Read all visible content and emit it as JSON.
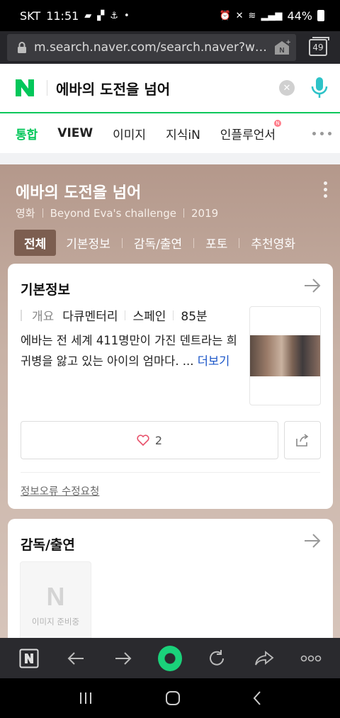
{
  "status_bar": {
    "carrier": "SKT",
    "time": "11:51",
    "battery": "44%"
  },
  "browser": {
    "url": "m.search.naver.com/search.naver?wher...",
    "tab_count": "49"
  },
  "search": {
    "query": "에바의 도전을 넘어"
  },
  "tabs": [
    {
      "label": "통합"
    },
    {
      "label": "VIEW"
    },
    {
      "label": "이미지"
    },
    {
      "label": "지식iN"
    },
    {
      "label": "인플루언서",
      "badge": "N"
    }
  ],
  "movie": {
    "title": "에바의 도전을 넘어",
    "category": "영화",
    "english_title": "Beyond Eva's challenge",
    "year": "2019",
    "subtabs": [
      "전체",
      "기본정보",
      "감독/출연",
      "포토",
      "추천영화"
    ]
  },
  "basic_info": {
    "heading": "기본정보",
    "overview_label": "개요",
    "genre": "다큐멘터리",
    "country": "스페인",
    "runtime": "85분",
    "description": "에바는 전 세계 411명만이 가진 덴트라는 희귀병을 앓고 있는 아이의 엄마다. ...",
    "more": "더보기",
    "likes": "2",
    "report": "정보오류 수정요청"
  },
  "cast": {
    "heading": "감독/출연",
    "placeholder_text": "이미지 준비중"
  },
  "colors": {
    "naver_green": "#03c75a",
    "brown_panel": "#b4988b"
  }
}
